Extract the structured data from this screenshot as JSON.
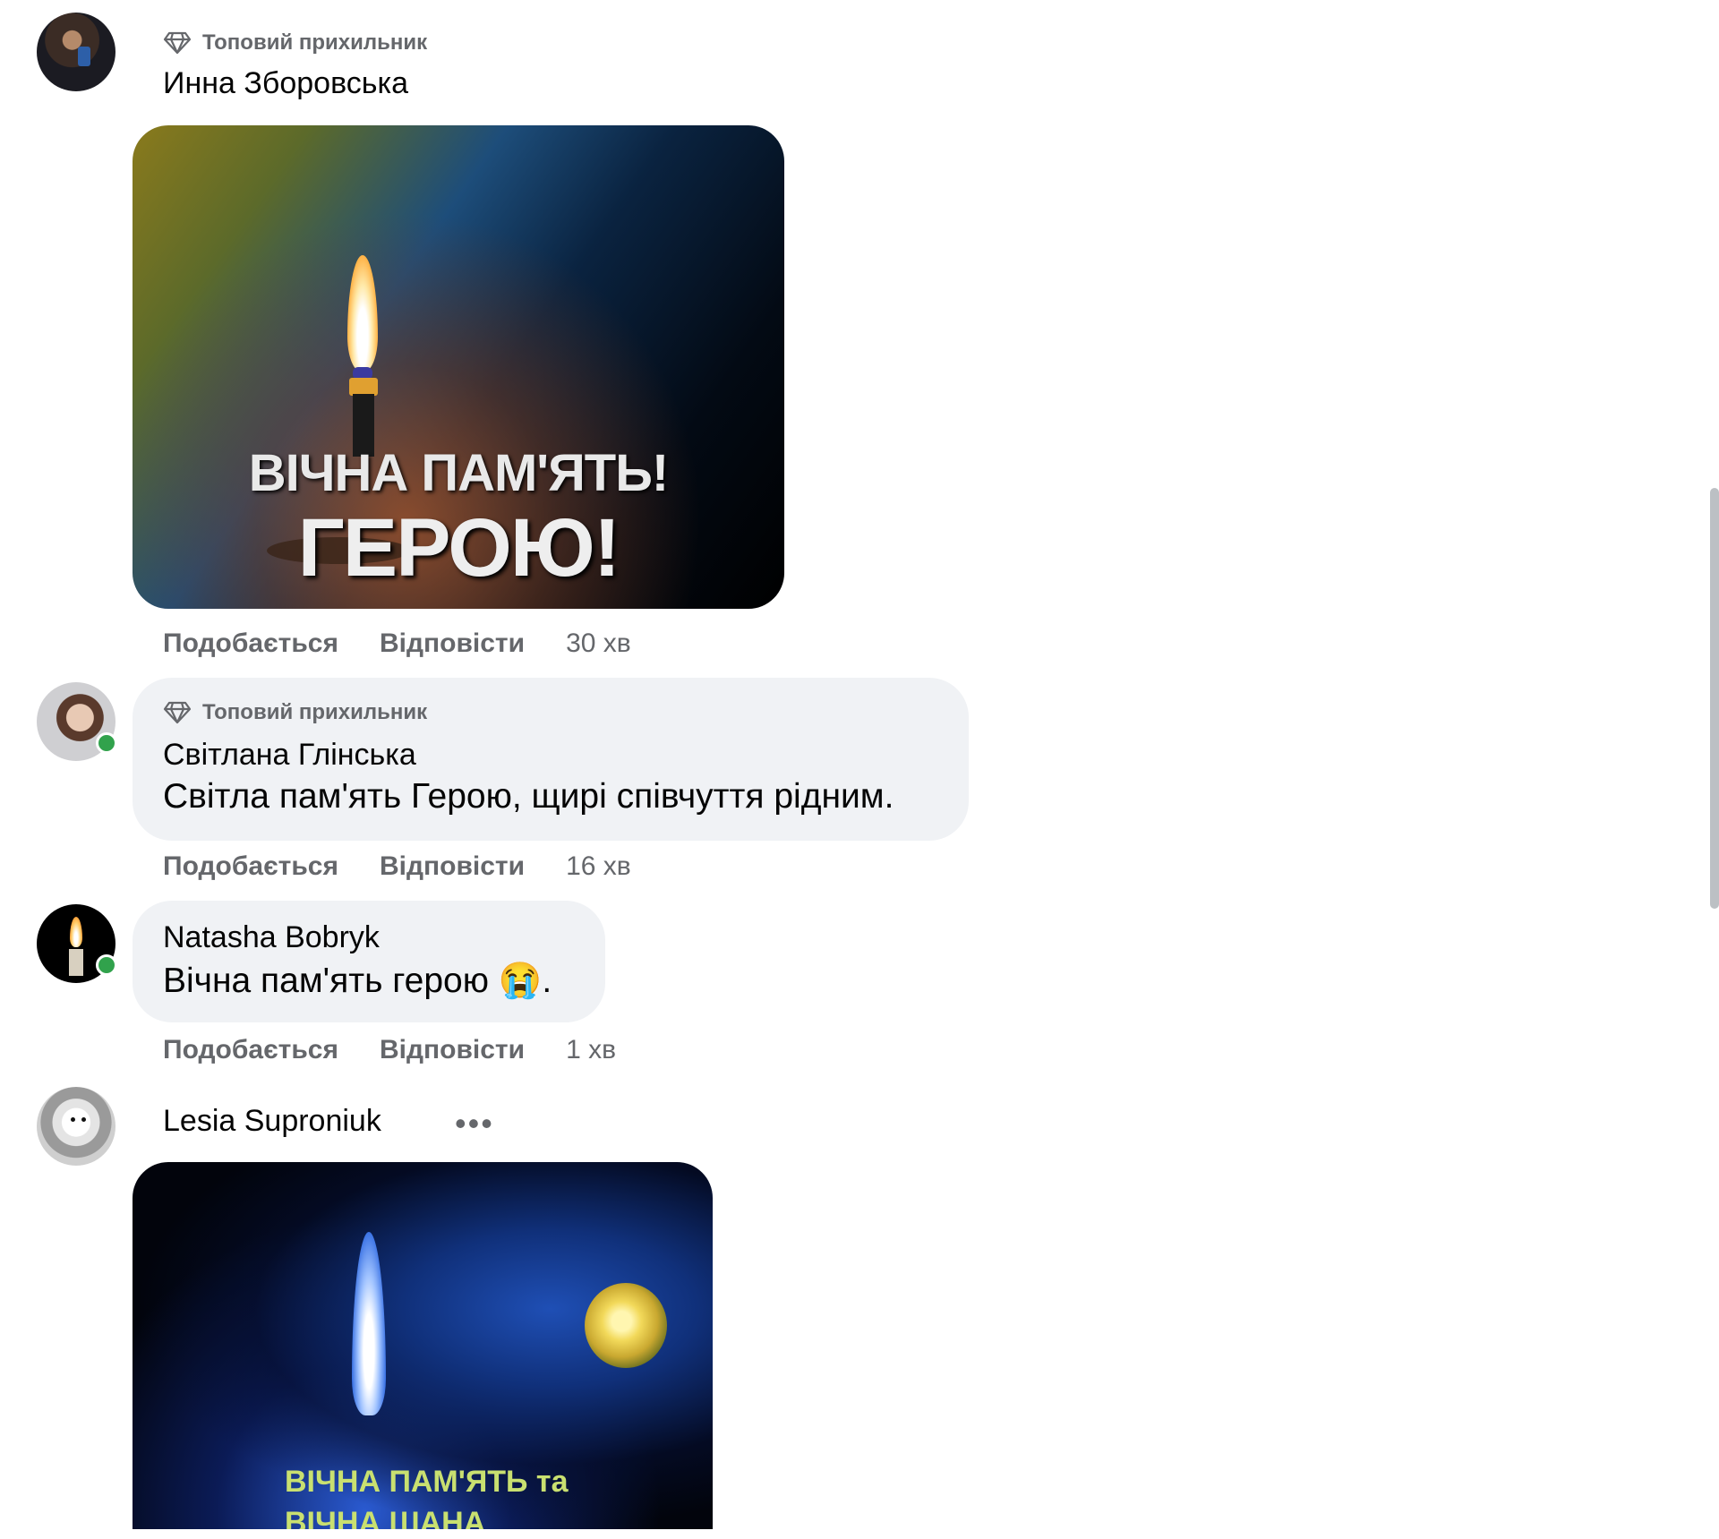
{
  "badge_label": "Топовий прихильник",
  "actions": {
    "like": "Подобається",
    "reply": "Відповісти"
  },
  "comments": [
    {
      "author": "Инна Зборовська",
      "time": "30 хв",
      "image_text_line1": "ВІЧНА ПАМ'ЯТЬ!",
      "image_text_line2": "ГЕРОЮ!"
    },
    {
      "author": "Світлана Глінська",
      "text": "Світла пам'ять Герою, щирі співчуття рідним.",
      "time": "16 хв"
    },
    {
      "author": "Natasha Bobryk",
      "text": "Вічна пам'ять герою",
      "emoji": "😭",
      "text_end": ".",
      "time": "1 хв"
    },
    {
      "author": "Lesia Suproniuk",
      "more_label": "•••",
      "image_text_line1": "ВІЧНА ПАМ'ЯТЬ та",
      "image_text_line2": "ВІЧНА ШАНА"
    }
  ],
  "colors": {
    "bubble": "#f0f2f5",
    "secondary_text": "#65676b",
    "online": "#31a24c"
  }
}
